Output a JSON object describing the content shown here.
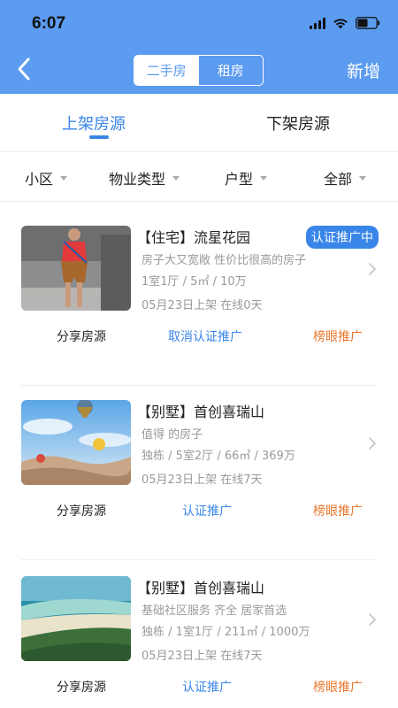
{
  "status": {
    "time": "6:07"
  },
  "header": {
    "segments": [
      {
        "label": "二手房",
        "active": true
      },
      {
        "label": "租房",
        "active": false
      }
    ],
    "add_label": "新增",
    "colors": {
      "bar": "#5b9bf0"
    }
  },
  "tabs": [
    {
      "label": "上架房源",
      "active": true
    },
    {
      "label": "下架房源",
      "active": false
    }
  ],
  "filters": [
    "小区",
    "物业类型",
    "户型",
    "全部"
  ],
  "listings": [
    {
      "title": "【住宅】流星花园",
      "badge": "认证推广中",
      "desc": "房子大又宽敞 性价比很高的房子",
      "spec": "1室1厅 / 5㎡ / 10万",
      "date": "05月23日上架 在线0天",
      "image": "fashion-model-photo",
      "actions": {
        "share": "分享房源",
        "cert": "取消认证推广",
        "hot": "榜眼推广"
      }
    },
    {
      "title": "【别墅】首创喜瑞山",
      "badge": "",
      "desc": "值得 的房子",
      "spec": "独栋 / 5室2厅 / 66㎡ / 369万",
      "date": "05月23日上架 在线7天",
      "image": "hot-air-balloons-photo",
      "actions": {
        "share": "分享房源",
        "cert": "认证推广",
        "hot": "榜眼推广"
      }
    },
    {
      "title": "【别墅】首创喜瑞山",
      "badge": "",
      "desc": "基础社区服务 齐全 居家首选",
      "spec": "独栋 / 1室1厅 / 211㎡ / 1000万",
      "date": "05月23日上架 在线7天",
      "image": "aerial-coastline-photo",
      "actions": {
        "share": "分享房源",
        "cert": "认证推广",
        "hot": "榜眼推广"
      }
    }
  ]
}
